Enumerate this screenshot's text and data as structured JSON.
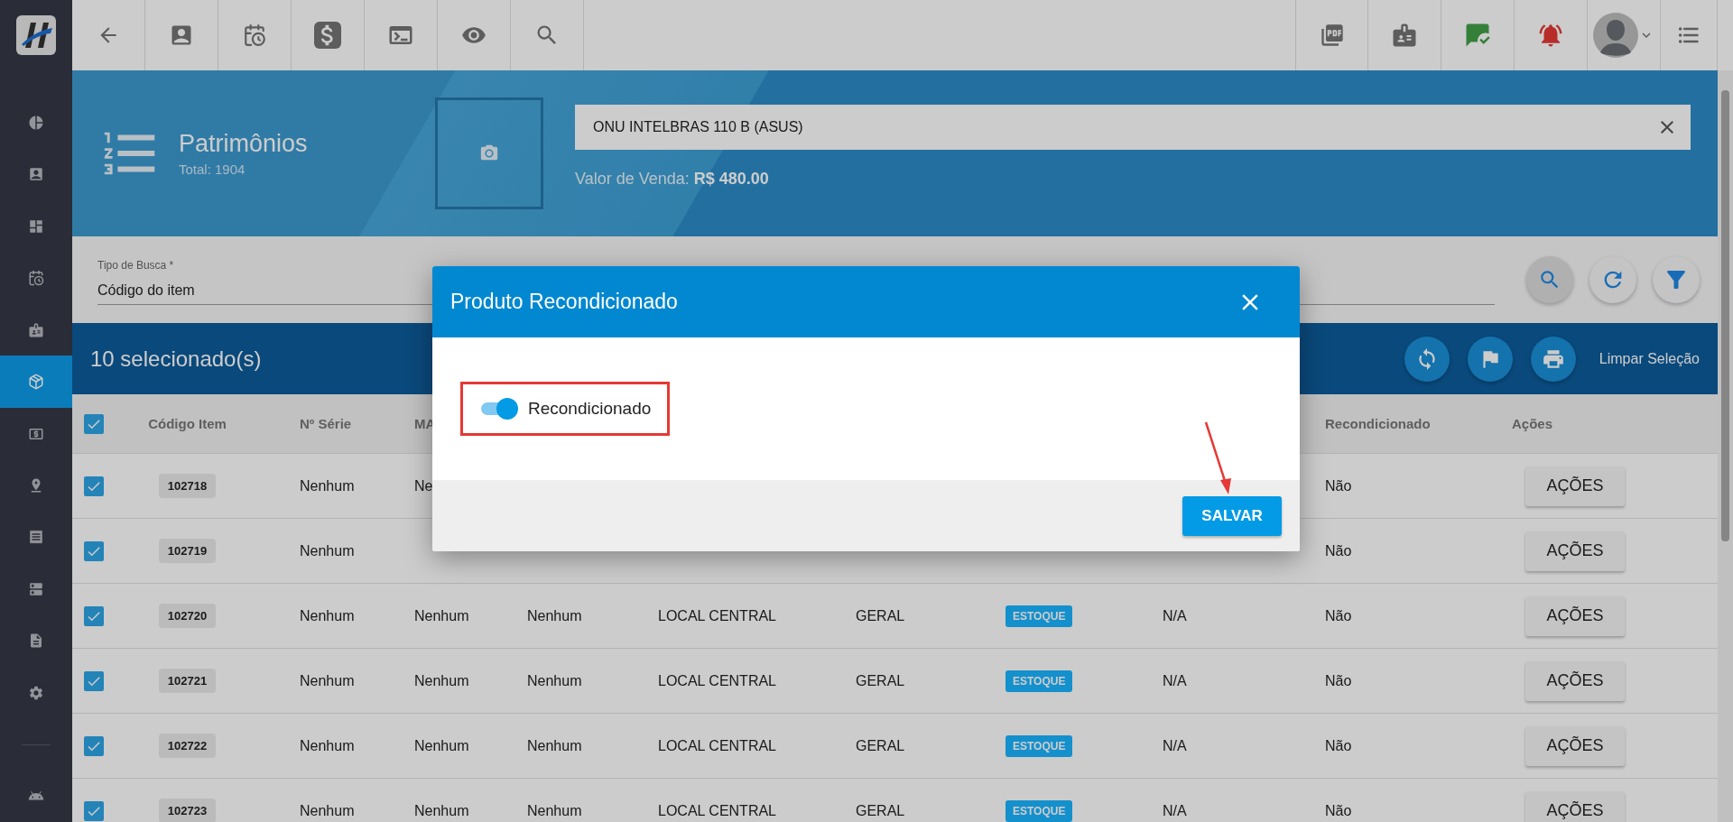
{
  "sidebar": {
    "items": [
      {
        "selected": false
      },
      {
        "selected": false
      },
      {
        "selected": false
      },
      {
        "selected": false
      },
      {
        "selected": false
      },
      {
        "selected": true
      },
      {
        "selected": false
      },
      {
        "selected": false
      },
      {
        "selected": false
      },
      {
        "selected": false
      },
      {
        "selected": false
      },
      {
        "selected": false
      },
      {
        "selected": false
      }
    ]
  },
  "page_header": {
    "title": "Patrimônios",
    "subtitle": "Total: 1904",
    "product_name": "ONU INTELBRAS 110 B (ASUS)",
    "price": "Valor de Venda: **R$ 480.00**"
  },
  "search": {
    "label": "Tipo de Busca *",
    "value": "Código do item"
  },
  "selection": {
    "count": "10 selecionado(s)",
    "clear": "Limpar Seleção"
  },
  "table": {
    "all_checked": true,
    "columns": [
      "Código Item",
      "Nº Série",
      "MA",
      null,
      null,
      null,
      null,
      null,
      "Recondicionado",
      "Ações"
    ],
    "rows": [
      {
        "selected": true,
        "cells": [
          "102718",
          "Nenhum",
          "Ne",
          null,
          null,
          null,
          null,
          null,
          "Não"
        ],
        "action": "AÇÕES"
      },
      {
        "selected": true,
        "cells": [
          "102719",
          "Nenhum",
          null,
          null,
          null,
          null,
          null,
          null,
          "Não"
        ],
        "action": "AÇÕES"
      },
      {
        "selected": true,
        "cells": [
          "102720",
          "Nenhum",
          "Nenhum",
          "Nenhum",
          "LOCAL CENTRAL",
          "GERAL",
          "ESTOQUE",
          "N/A",
          "Não"
        ],
        "action": "AÇÕES"
      },
      {
        "selected": true,
        "cells": [
          "102721",
          "Nenhum",
          "Nenhum",
          "Nenhum",
          "LOCAL CENTRAL",
          "GERAL",
          "ESTOQUE",
          "N/A",
          "Não"
        ],
        "action": "AÇÕES"
      },
      {
        "selected": true,
        "cells": [
          "102722",
          "Nenhum",
          "Nenhum",
          "Nenhum",
          "LOCAL CENTRAL",
          "GERAL",
          "ESTOQUE",
          "N/A",
          "Não"
        ],
        "action": "AÇÕES"
      },
      {
        "selected": true,
        "cells": [
          "102723",
          "Nenhum",
          "Nenhum",
          "Nenhum",
          "LOCAL CENTRAL",
          "GERAL",
          "ESTOQUE",
          "N/A",
          "Não"
        ],
        "action": "AÇÕES"
      }
    ]
  },
  "dialog": {
    "title": "Produto Recondicionado",
    "toggle": {
      "label": "Recondicionado",
      "on": true
    },
    "save": "SALVAR"
  }
}
